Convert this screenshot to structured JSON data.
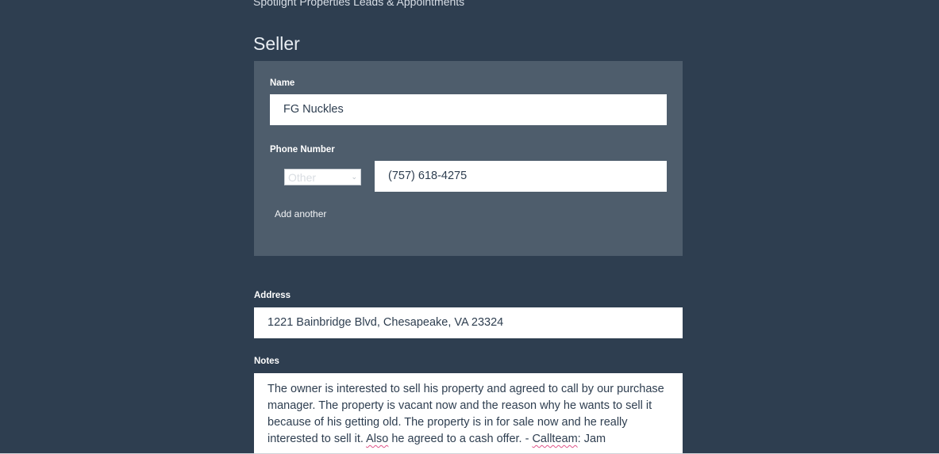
{
  "header": {
    "title": "Spotlight Properties Leads & Appointments"
  },
  "seller": {
    "section_title": "Seller",
    "name_label": "Name",
    "name_value": "FG Nuckles",
    "phone_label": "Phone Number",
    "phone_type_selected": "Other",
    "phone_value": "(757) 618-4275",
    "add_another_label": "Add another"
  },
  "address": {
    "label": "Address",
    "value": "1221 Bainbridge Blvd, Chesapeake, VA 23324"
  },
  "notes": {
    "label": "Notes",
    "part1": "The owner is interested to sell his property and agreed to call by our purchase manager. The property is vacant now and the reason why he wants to sell it because of his getting old. The property is in for sale now and he really interested to sell it. ",
    "word_also": "Also",
    "part2": " he agreed to a cash offer. - ",
    "word_callteam": "Callteam",
    "part3": ": Jam"
  },
  "colors": {
    "background": "#2e3e50",
    "panel": "#4e5d6c",
    "input_bg": "#ffffff",
    "input_text": "#2e3e50",
    "spellcheck_underline": "#e0558a"
  },
  "icons": {
    "select_arrow": "chevron-down-icon"
  }
}
